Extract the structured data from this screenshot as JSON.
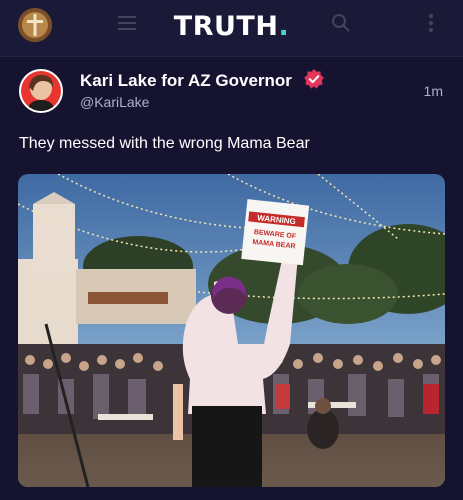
{
  "header": {
    "logo_text": "TRUTH",
    "logo_dot": ".",
    "accent_color": "#4bd1c2"
  },
  "post": {
    "author": "Kari Lake for AZ Governor",
    "verified_color": "#e2365a",
    "handle": "@KariLake",
    "time": "1m",
    "text": "They messed with the wrong Mama Bear",
    "image": {
      "sign_line1": "WARNING",
      "sign_line2": "BEWARE OF",
      "sign_line3": "MAMA BEAR"
    }
  },
  "icons": {
    "menu": "menu-icon",
    "search": "search-icon",
    "more": "more-icon",
    "verified": "verified-badge-icon"
  }
}
